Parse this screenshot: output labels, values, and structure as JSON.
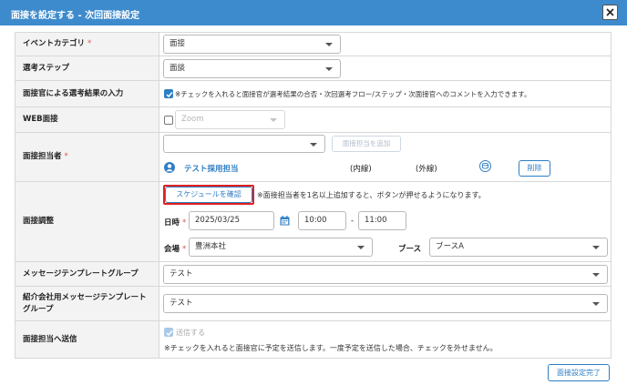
{
  "dialog": {
    "title": "面接を設定する - 次回面接設定"
  },
  "rows": {
    "event_category": {
      "label": "イベントカテゴリ",
      "required": "*",
      "value": "面接"
    },
    "selection_step": {
      "label": "選考ステップ",
      "value": "面談"
    },
    "interviewer_input": {
      "label": "面接官による選考結果の入力",
      "checked": true,
      "note": "※チェックを入れると面接官が選考結果の合否・次回選考フロー/ステップ・次面接官へのコメントを入力できます。"
    },
    "web_interview": {
      "label": "WEB面接",
      "checked": false,
      "value": "Zoom"
    },
    "interviewer": {
      "label": "面接担当者",
      "required": "*",
      "select_value": "",
      "add_button": "面接担当を追加",
      "person_name": "テスト採用担当",
      "inline": "(内線)",
      "outline": "(外線)",
      "delete_button": "削除"
    },
    "schedule": {
      "label": "面接調整",
      "check_button": "スケジュールを確認",
      "check_note": "※面接担当者を1名以上追加すると、ボタンが押せるようになります。",
      "date_label": "日時",
      "date_required": "*",
      "date": "2025/03/25",
      "start": "10:00",
      "dash": "-",
      "end": "11:00",
      "venue_label": "会場",
      "venue_required": "*",
      "venue": "豊洲本社",
      "booth_label": "ブース",
      "booth": "ブースA"
    },
    "message_template": {
      "label": "メッセージテンプレートグループ",
      "value": "テスト"
    },
    "referral_template": {
      "label": "紹介会社用メッセージテンプレートグループ",
      "value": "テスト"
    },
    "send_to_interviewer": {
      "label": "面接担当へ送信",
      "checkbox_label": "送信する",
      "checked": true,
      "note": "※チェックを入れると面接官に予定を送信します。一度予定を送信した場合、チェックを外せません。"
    }
  },
  "footer": {
    "complete_button": "面接設定完了"
  },
  "colors": {
    "header": "#3d8bcd",
    "accent": "#2f7ec4",
    "required": "#d9534f",
    "highlight": "#e02020"
  }
}
